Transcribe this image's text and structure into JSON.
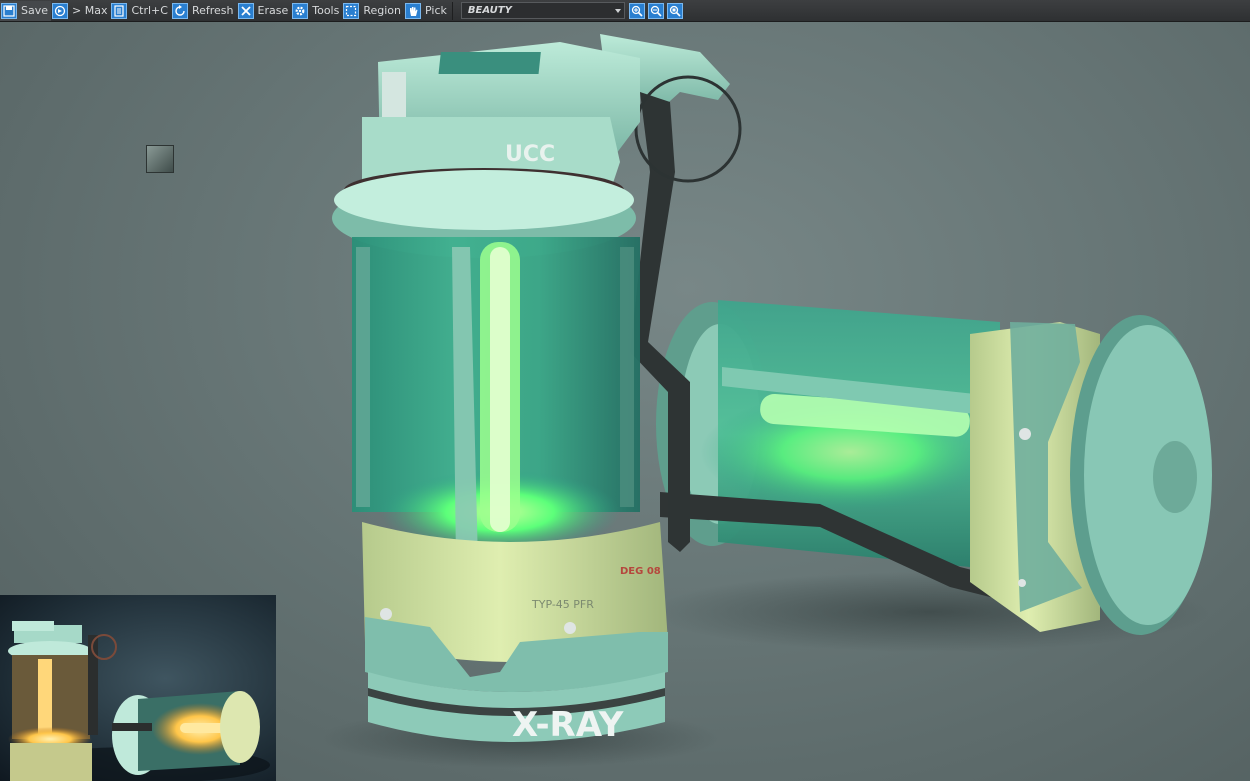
{
  "toolbar": {
    "buttons": [
      {
        "label": "Save",
        "icon": "save-icon"
      },
      {
        "label": "> Max",
        "icon": "max-icon"
      },
      {
        "label": "Ctrl+C",
        "icon": "copy-icon"
      },
      {
        "label": "Refresh",
        "icon": "refresh-icon"
      },
      {
        "label": "Erase",
        "icon": "erase-icon"
      },
      {
        "label": "Tools",
        "icon": "gear-icon"
      },
      {
        "label": "Region",
        "icon": "region-icon"
      },
      {
        "label": "Pick",
        "icon": "hand-icon"
      }
    ],
    "channel": "BEAUTY",
    "zoom_icons": [
      "zoom-in-icon",
      "zoom-out-icon",
      "zoom-fit-icon"
    ]
  },
  "render": {
    "cap_label": "UCC",
    "band_label": "TYP-45 PFR",
    "red_label": "DEG  08",
    "brand_label": "X-RAY",
    "colors": {
      "body": "#9fdcc8",
      "band": "#cfe3a0",
      "glow": "#5cff7a",
      "glass": "#2f9e86",
      "thumbnail_glow": "#ffc64a"
    }
  }
}
